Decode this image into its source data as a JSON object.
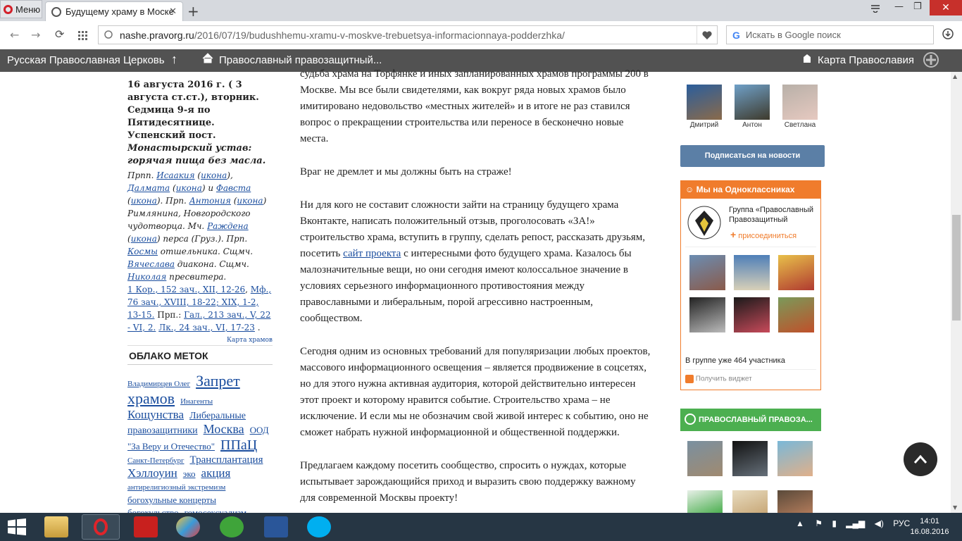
{
  "browser": {
    "menu_label": "Меню",
    "tab_title": "Будущему храму в Моске",
    "tab_close": "✕",
    "url_host": "nashe.pravorg.ru",
    "url_path": "/2016/07/19/budushhemu-xramu-v-moskve-trebuetsya-informacionnaya-podderzhka/",
    "search_placeholder": "Искать в Google поиск"
  },
  "site_nav": {
    "left_item": "Русская Православная Церковь",
    "middle_item": "Православный правозащитный...",
    "right_item": "Карта Православия"
  },
  "sidebar": {
    "date_bold": "16 августа 2016 г. ( 3 августа ст.ст.), вторник.",
    "week_bold": "Седмица 9-я по Пятидесятнице. Успенский пост.",
    "rule_bold_italic": "Монастырский устав: горячая пища без масла.",
    "saints": [
      {
        "t": "Прпп. ",
        "l": false
      },
      {
        "t": "Исаакия",
        "l": true
      },
      {
        "t": " (",
        "l": false
      },
      {
        "t": "икона",
        "l": true
      },
      {
        "t": "), ",
        "l": false
      },
      {
        "t": "Далмата",
        "l": true
      },
      {
        "t": " (",
        "l": false
      },
      {
        "t": "икона",
        "l": true
      },
      {
        "t": ") и ",
        "l": false
      },
      {
        "t": "Фавста",
        "l": true
      },
      {
        "t": " (",
        "l": false
      },
      {
        "t": "икона",
        "l": true
      },
      {
        "t": "). Прп. ",
        "l": false
      },
      {
        "t": "Антония",
        "l": true
      },
      {
        "t": " (",
        "l": false
      },
      {
        "t": "икона",
        "l": true
      },
      {
        "t": ") Римлянина, Новгородского чудотворца. Мч. ",
        "l": false
      },
      {
        "t": "Раждена",
        "l": true
      },
      {
        "t": " (",
        "l": false
      },
      {
        "t": "икона",
        "l": true
      },
      {
        "t": ") перса (Груз.). Прп. ",
        "l": false
      },
      {
        "t": "Космы",
        "l": true
      },
      {
        "t": " отшельника. Сщмч. ",
        "l": false
      },
      {
        "t": "Вячеслава",
        "l": true
      },
      {
        "t": " диакона. Сщмч. ",
        "l": false
      },
      {
        "t": "Николая",
        "l": true
      },
      {
        "t": " пресвитера.",
        "l": false
      }
    ],
    "readings": [
      {
        "t": "1 Кор., 152 зач., XII, 12-26",
        "l": true
      },
      {
        "t": ", ",
        "l": false
      },
      {
        "t": "Мф., 76 зач., XVIII, 18-22; XIX, 1-2, 13-15.",
        "l": true
      },
      {
        "t": " Прп.: ",
        "l": false
      },
      {
        "t": "Гал., 213 зач., V, 22 - VI, 2.",
        "l": true
      },
      {
        "t": " ",
        "l": false
      },
      {
        "t": "Лк., 24 зач., VI, 17-23",
        "l": true
      },
      {
        "t": " .",
        "l": false
      }
    ],
    "map_link": "Карта храмов",
    "cloud_title": "ОБЛАКО МЕТОК",
    "tags": [
      {
        "t": "Владимирцев Олег",
        "s": 11
      },
      {
        "t": "Запрет храмов",
        "s": 22
      },
      {
        "t": "Инагенты",
        "s": 11
      },
      {
        "t": "Кощунства",
        "s": 17
      },
      {
        "t": "Либеральные правозащитники",
        "s": 14
      },
      {
        "t": "Москва",
        "s": 18
      },
      {
        "t": "ООД \"За Веру и Отечество\"",
        "s": 13
      },
      {
        "t": "ППаЦ",
        "s": 20
      },
      {
        "t": "Санкт-Петербург",
        "s": 11
      },
      {
        "t": "Трансплантация",
        "s": 15
      },
      {
        "t": "Хэллоуин",
        "s": 17
      },
      {
        "t": "эко",
        "s": 13
      },
      {
        "t": "акция",
        "s": 17
      },
      {
        "t": "антирелигиозный экстремизм",
        "s": 11
      },
      {
        "t": "богохульные концерты",
        "s": 13
      },
      {
        "t": "богохульство",
        "s": 13
      },
      {
        "t": "гомосексуализм",
        "s": 13
      }
    ]
  },
  "article": {
    "p0": "судьба храма на Торфянке и иных запланированных храмов программы 200 в Москве. Мы все были свидетелями, как вокруг ряда новых храмов было имитировано недовольство «местных жителей» и в итоге не раз ставился вопрос о прекращении строительства или переносе в бесконечно новые места.",
    "p1": "Враг не дремлет и мы должны быть на страже!",
    "p2_before": "Ни для кого не составит сложности зайти на страницу будущего храма Вконтакте, написать положительный отзыв, проголосовать «ЗА!» строительство храма, вступить в группу, сделать репост, рассказать друзьям, посетить ",
    "p2_link": "сайт проекта",
    "p2_after": " с интересными фото будущего храма. Казалось бы малозначительные вещи, но они сегодня имеют колоссальное значение в условиях серьезного информационного противостояния между православными и либеральным, порой агрессивно настроенным, сообществом.",
    "p3": "Сегодня одним из основных требований для популяризации любых проектов, массового информационного освещения – является продвижение в соцсетях, но для этого нужна активная аудитория, которой действительно интересен этот проект и которому нравится событие. Строительство храма – не исключение. И если мы не обозначим свой живой интерес к событию, оно не сможет набрать нужной информационной и общественной поддержки.",
    "p4": "Предлагаем каждому посетить сообщество, спросить о нуждах, которые испытывает зарождающийся приход и выразить свою поддержку важному для современной Москвы проекту!"
  },
  "right": {
    "members": [
      "Дмитрий",
      "Антон",
      "Светлана"
    ],
    "subscribe_label": "Подписаться на новости",
    "ok_title": "Мы на Одноклассниках",
    "ok_group": "Группа «Православный Правозащитный",
    "ok_join": "присоединиться",
    "ok_count": "В группе уже 464 участника",
    "ok_widget_link": "Получить виджет",
    "vk_title": "ПРАВОСЛАВНЫЙ ПРАВОЗА..."
  },
  "taskbar": {
    "lang": "РУС",
    "time": "14:01",
    "date": "16.08.2016"
  },
  "colors": {
    "site_nav_bg": "#525252",
    "subscribe_bg": "#5b7fa6",
    "ok_orange": "#f07c2c",
    "vk_green": "#4caf50",
    "link_blue": "#1a4d9e",
    "taskbar_bg": "#263644"
  }
}
